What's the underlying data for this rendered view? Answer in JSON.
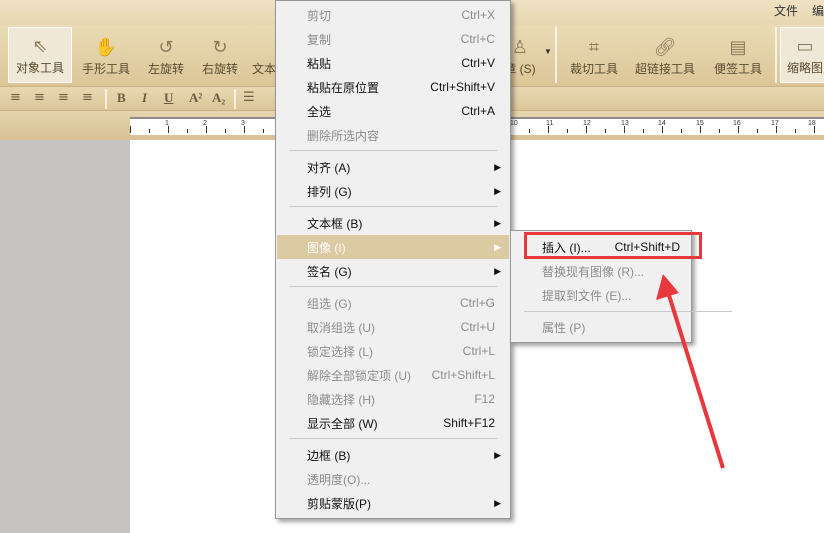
{
  "menubar": [
    "文件",
    "编"
  ],
  "toolbar": [
    {
      "label": "对象工具",
      "icon": "cursor-icon"
    },
    {
      "label": "手形工具",
      "icon": "hand-icon"
    },
    {
      "label": "左旋转",
      "icon": "rotate-left-icon"
    },
    {
      "label": "右旋转",
      "icon": "rotate-right-icon"
    },
    {
      "label": "文本",
      "icon": "text-icon"
    },
    {
      "label": "章 (S)",
      "icon": "stamp-icon"
    },
    {
      "label": "裁切工具",
      "icon": "crop-icon"
    },
    {
      "label": "超链接工具",
      "icon": "link-icon"
    },
    {
      "label": "便签工具",
      "icon": "note-icon"
    },
    {
      "label": "缩略图",
      "icon": "thumbnail-icon"
    }
  ],
  "format": [
    "B",
    "I",
    "U",
    "A²",
    "A₂"
  ],
  "ruler": [
    "1",
    "2",
    "3",
    "10",
    "11",
    "12",
    "13",
    "14",
    "15",
    "16",
    "17",
    "18"
  ],
  "context_menu": [
    {
      "label": "剪切",
      "shortcut": "Ctrl+X",
      "disabled": true
    },
    {
      "label": "复制",
      "shortcut": "Ctrl+C",
      "disabled": true
    },
    {
      "label": "粘贴",
      "shortcut": "Ctrl+V"
    },
    {
      "label": "粘贴在原位置",
      "shortcut": "Ctrl+Shift+V"
    },
    {
      "label": "全选",
      "shortcut": "Ctrl+A"
    },
    {
      "label": "删除所选内容",
      "shortcut": "",
      "disabled": true
    },
    {
      "label": "对齐 (A)",
      "submenu": true
    },
    {
      "label": "排列 (G)",
      "submenu": true
    },
    {
      "label": "文本框 (B)",
      "submenu": true
    },
    {
      "label": "图像 (I)",
      "submenu": true,
      "highlighted": true
    },
    {
      "label": "签名 (G)",
      "submenu": true
    },
    {
      "label": "组选 (G)",
      "shortcut": "Ctrl+G",
      "disabled": true
    },
    {
      "label": "取消组选 (U)",
      "shortcut": "Ctrl+U",
      "disabled": true
    },
    {
      "label": "锁定选择 (L)",
      "shortcut": "Ctrl+L",
      "disabled": true
    },
    {
      "label": "解除全部锁定项 (U)",
      "shortcut": "Ctrl+Shift+L",
      "disabled": true
    },
    {
      "label": "隐藏选择 (H)",
      "shortcut": "F12",
      "disabled": true
    },
    {
      "label": "显示全部 (W)",
      "shortcut": "Shift+F12"
    },
    {
      "label": "边框 (B)",
      "submenu": true
    },
    {
      "label": "透明度(O)...",
      "disabled": true
    },
    {
      "label": "剪贴蒙版(P)",
      "submenu": true
    }
  ],
  "image_submenu": [
    {
      "label": "插入 (I)...",
      "shortcut": "Ctrl+Shift+D"
    },
    {
      "label": "替换现有图像 (R)...",
      "disabled": true
    },
    {
      "label": "提取到文件 (E)...",
      "disabled": true
    },
    {
      "label": "属性 (P)",
      "disabled": true
    }
  ],
  "colors": {
    "highlight": "#dccaa2",
    "annotation": "#e8383d"
  }
}
